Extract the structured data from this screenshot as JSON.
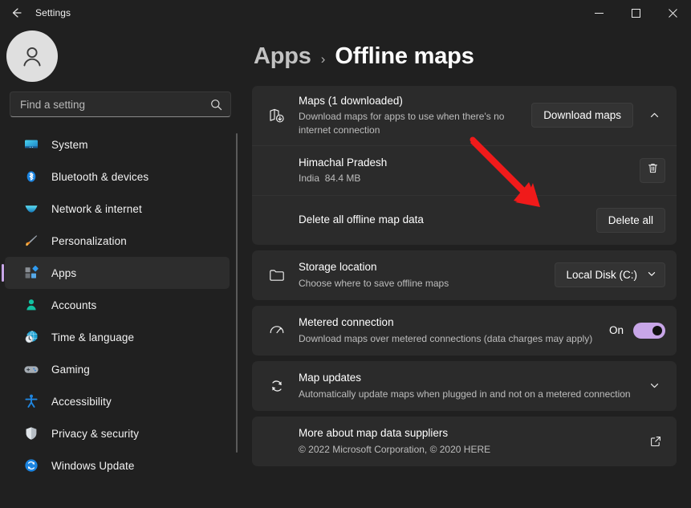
{
  "titlebar": {
    "back_label": "Back",
    "title": "Settings",
    "minimize_label": "Minimize",
    "maximize_label": "Maximize",
    "close_label": "Close"
  },
  "sidebar": {
    "avatar_name": "user-avatar",
    "search": {
      "placeholder": "Find a setting",
      "value": ""
    },
    "items": [
      {
        "label": "System",
        "icon": "monitor-icon",
        "selected": false
      },
      {
        "label": "Bluetooth & devices",
        "icon": "bluetooth-icon",
        "selected": false
      },
      {
        "label": "Network & internet",
        "icon": "wifi-icon",
        "selected": false
      },
      {
        "label": "Personalization",
        "icon": "paintbrush-icon",
        "selected": false
      },
      {
        "label": "Apps",
        "icon": "apps-icon",
        "selected": true
      },
      {
        "label": "Accounts",
        "icon": "person-icon",
        "selected": false
      },
      {
        "label": "Time & language",
        "icon": "clock-globe-icon",
        "selected": false
      },
      {
        "label": "Gaming",
        "icon": "gamepad-icon",
        "selected": false
      },
      {
        "label": "Accessibility",
        "icon": "accessibility-icon",
        "selected": false
      },
      {
        "label": "Privacy & security",
        "icon": "shield-icon",
        "selected": false
      },
      {
        "label": "Windows Update",
        "icon": "update-icon",
        "selected": false
      }
    ]
  },
  "breadcrumb": {
    "parent": "Apps",
    "separator": "›",
    "current": "Offline maps"
  },
  "main": {
    "maps_card": {
      "title": "Maps (1 downloaded)",
      "subtitle": "Download maps for apps to use when there's no internet connection",
      "download_button": "Download maps",
      "expand_state": "expanded",
      "downloaded_map": {
        "name": "Himachal Pradesh",
        "region": "India",
        "size": "84.4 MB",
        "delete_icon_label": "trash-icon"
      },
      "delete_all_row": {
        "label": "Delete all offline map data",
        "button": "Delete all"
      }
    },
    "storage_card": {
      "title": "Storage location",
      "subtitle": "Choose where to save offline maps",
      "selected_value": "Local Disk (C:)"
    },
    "metered_card": {
      "title": "Metered connection",
      "subtitle": "Download maps over metered connections (data charges may apply)",
      "toggle_state": "On"
    },
    "updates_card": {
      "title": "Map updates",
      "subtitle": "Automatically update maps when plugged in and not on a metered connection"
    },
    "suppliers_card": {
      "title": "More about map data suppliers",
      "subtitle": "© 2022 Microsoft Corporation, © 2020 HERE"
    }
  },
  "annotation": {
    "type": "arrow",
    "color": "#f01a1a",
    "points_to": "Delete all"
  },
  "colors": {
    "page_background": "#202020",
    "card_background": "#2b2b2b",
    "accent": "#c8a6e8",
    "annotation_red": "#f01a1a"
  }
}
